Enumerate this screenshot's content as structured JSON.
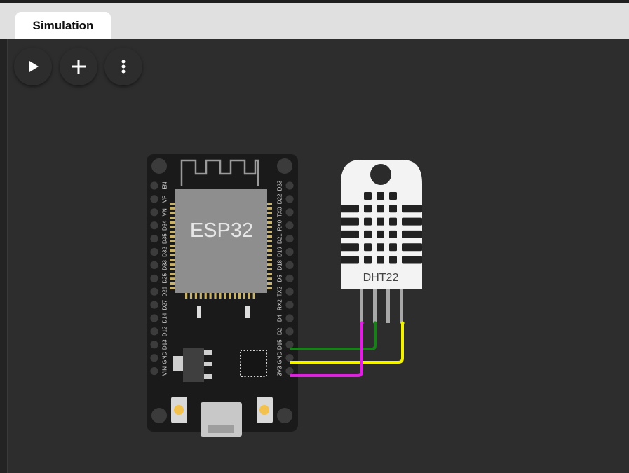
{
  "tabs": [
    {
      "label": "Simulation",
      "active": true
    }
  ],
  "toolbar": {
    "play": {
      "icon": "play-icon",
      "color": "#43a047"
    },
    "add": {
      "icon": "plus-icon",
      "color": "#1565c0"
    },
    "more": {
      "icon": "more-vertical-icon",
      "color": "#757575"
    }
  },
  "esp32": {
    "label": "ESP32",
    "left_pins": [
      "EN",
      "VP",
      "VN",
      "D34",
      "D35",
      "D32",
      "D33",
      "D25",
      "D26",
      "D27",
      "D14",
      "D12",
      "D13",
      "GND",
      "VIN"
    ],
    "right_pins": [
      "D23",
      "D22",
      "TX0",
      "RX0",
      "D21",
      "D19",
      "D18",
      "D5",
      "TX2",
      "RX2",
      "D4",
      "D2",
      "D15",
      "GND",
      "3V3"
    ]
  },
  "dht22": {
    "label": "DHT22"
  },
  "wires": [
    {
      "from": "D15",
      "to": "DHT22 pin 2",
      "color": "#1b7d1b"
    },
    {
      "from": "GND",
      "to": "DHT22 pin 4",
      "color": "#f2f200"
    },
    {
      "from": "3V3",
      "to": "DHT22 pin 1",
      "color": "#e020e0"
    }
  ]
}
